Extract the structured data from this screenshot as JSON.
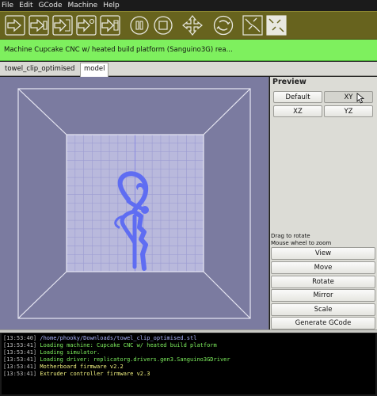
{
  "menu": [
    "File",
    "Edit",
    "GCode",
    "Machine",
    "Help"
  ],
  "toolbar": {
    "buttons": [
      "build-icon",
      "upload-icon",
      "build-to-file-icon",
      "build-to-remote-file-icon",
      "build-to-sd-icon",
      "pause-icon",
      "stop-icon",
      "jog-icon",
      "reset-icon",
      "connect-icon",
      "disconnect-icon"
    ]
  },
  "status": {
    "text": "Machine Cupcake CNC w/ heated build platform (Sanguino3G) rea..."
  },
  "tabs": [
    "towel_clip_optimised",
    "model"
  ],
  "preview": {
    "title": "Preview",
    "buttons": [
      "Default",
      "XY",
      "XZ",
      "YZ"
    ],
    "hint_rotate": "Drag to rotate",
    "hint_zoom": "Mouse wheel to zoom"
  },
  "actions": [
    "View",
    "Move",
    "Rotate",
    "Mirror",
    "Scale",
    "Generate GCode"
  ],
  "console": [
    {
      "ts": "[13:53:40]",
      "msg": " /home/phooky/Downloads/towel_clip_optimised.stl",
      "color": "#aab4ff"
    },
    {
      "ts": "[13:53:41]",
      "msg": " Loading machine: Cupcake CNC w/ heated build platform",
      "color": "#7ef05e"
    },
    {
      "ts": "[13:53:41]",
      "msg": " Loading simulator.",
      "color": "#7ef05e"
    },
    {
      "ts": "[13:53:41]",
      "msg": " Loading driver: replicatorg.drivers.gen3.Sanguino3GDriver",
      "color": "#7ef05e"
    },
    {
      "ts": "[13:53:41]",
      "msg": " Motherboard firmware v2.2",
      "color": "#f0f080"
    },
    {
      "ts": "[13:53:41]",
      "msg": " Extruder controller firmware v2.3",
      "color": "#f0f080"
    }
  ],
  "colors": {
    "toolbar": "#67631e",
    "status_bar": "#7ef05e",
    "viewport": "#7b7ba0",
    "build_plate": "#b9b9dc",
    "model": "#5f6df2"
  }
}
